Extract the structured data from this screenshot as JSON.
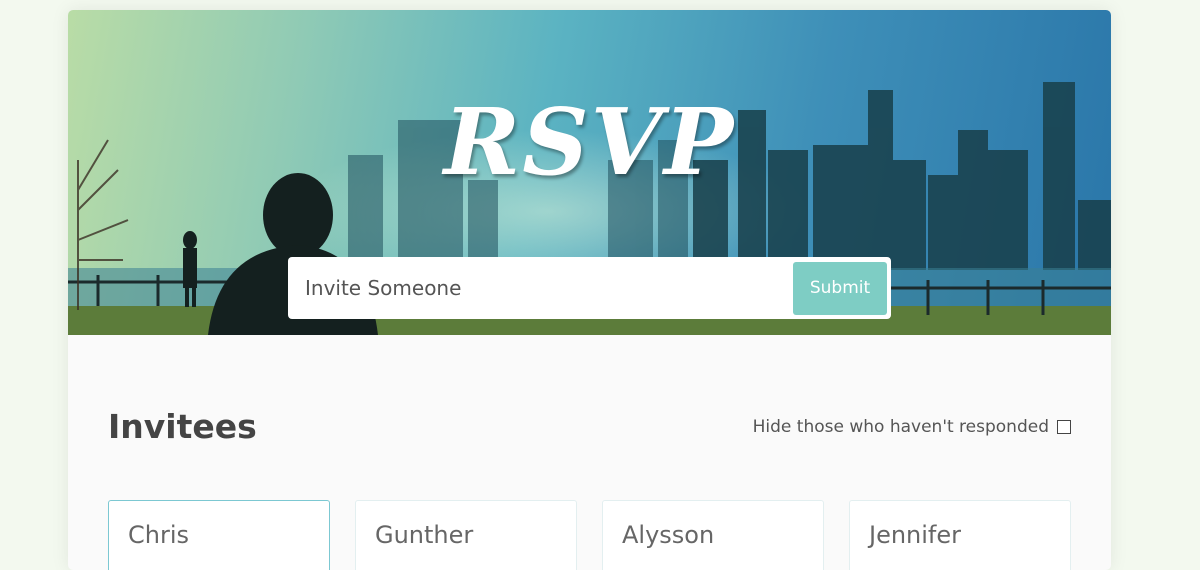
{
  "header": {
    "title": "RSVP"
  },
  "invite_form": {
    "placeholder": "Invite Someone",
    "value": "",
    "submit_label": "Submit"
  },
  "main": {
    "heading": "Invitees",
    "filter_label": "Hide those who haven't responded",
    "filter_checked": false
  },
  "invitees": [
    {
      "name": "Chris"
    },
    {
      "name": "Gunther"
    },
    {
      "name": "Alysson"
    },
    {
      "name": "Jennifer"
    }
  ],
  "colors": {
    "accent": "#7ecdc4",
    "heading": "#444444",
    "page_bg": "#f3f9ef"
  }
}
